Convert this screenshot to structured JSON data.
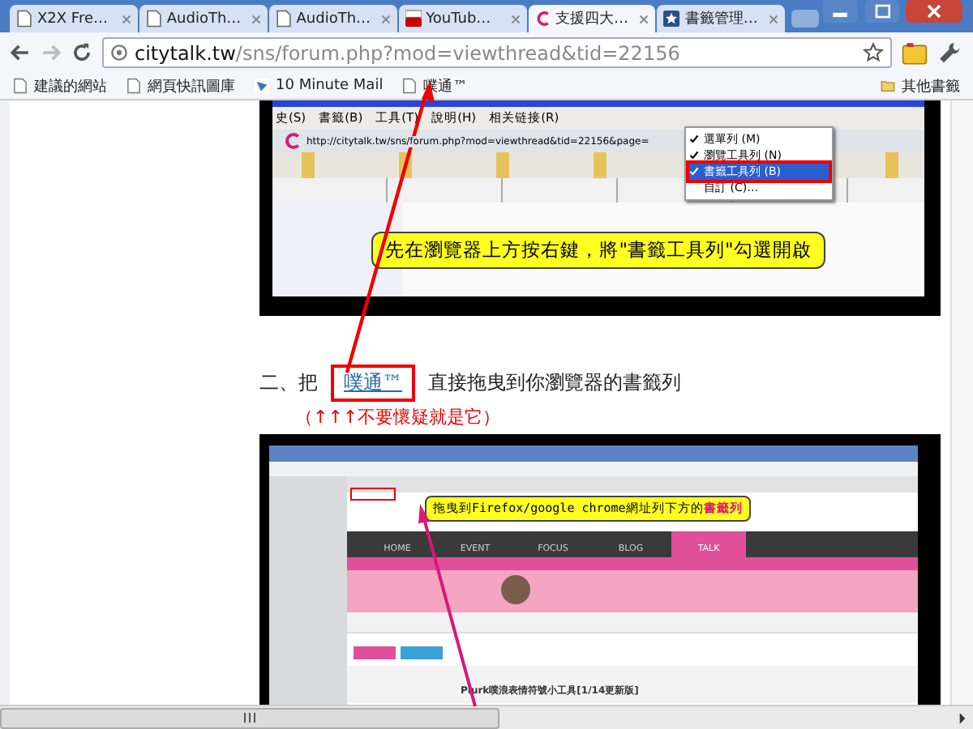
{
  "tabs": [
    {
      "label": "X2X Fre…",
      "kind": "page",
      "selected": false
    },
    {
      "label": "AudioTh…",
      "kind": "page",
      "selected": false
    },
    {
      "label": "AudioTh…",
      "kind": "page",
      "selected": false
    },
    {
      "label": "YouTub…",
      "kind": "youtube",
      "selected": false
    },
    {
      "label": "支援四大…",
      "kind": "citytalk",
      "selected": true
    },
    {
      "label": "書籤管理…",
      "kind": "star",
      "selected": false
    }
  ],
  "address": {
    "host": "citytalk.tw",
    "path": "/sns/forum.php?mod=viewthread&tid=22156"
  },
  "bookmarks": [
    {
      "label": "建議的網站",
      "kind": "page"
    },
    {
      "label": "網頁快訊圖庫",
      "kind": "page"
    },
    {
      "label": "10 Minute Mail",
      "kind": "mail"
    },
    {
      "label": "噗通™",
      "kind": "page"
    }
  ],
  "other_bookmarks": "其他書籤",
  "figure_1": {
    "menu": [
      "史(S)",
      "書籤(B)",
      "工具(T)",
      "說明(H)",
      "相关链接(R)"
    ],
    "address": "http://citytalk.tw/sns/forum.php?mod=viewthread&tid=22156&page=",
    "context_menu": [
      {
        "label": "選單列 (M)",
        "checked": true,
        "selected": false
      },
      {
        "label": "瀏覽工具列 (N)",
        "checked": true,
        "selected": false
      },
      {
        "label": "書籤工具列 (B)",
        "checked": true,
        "selected": true
      },
      {
        "label": "自訂 (C)…",
        "checked": false,
        "selected": false
      }
    ],
    "callout": "先在瀏覽器上方按右鍵，將\"書籤工具列\"勾選開啟"
  },
  "step_text": {
    "before": "二、把",
    "link": "噗通™",
    "after": "直接拖曳到你瀏覽器的書籤列"
  },
  "step_note": "（↑↑↑不要懷疑就是它）",
  "figure_2": {
    "callout": "拖曳到Firefox/google chrome網址列下方的**書籤列**",
    "nav": [
      {
        "label": "HOME",
        "selected": false
      },
      {
        "label": "EVENT",
        "selected": false
      },
      {
        "label": "FOCUS",
        "selected": false
      },
      {
        "label": "BLOG",
        "selected": false
      },
      {
        "label": "TALK",
        "selected": true
      }
    ],
    "post_title": "Plurk噗浪表情符號小工具[1/14更新版]"
  }
}
